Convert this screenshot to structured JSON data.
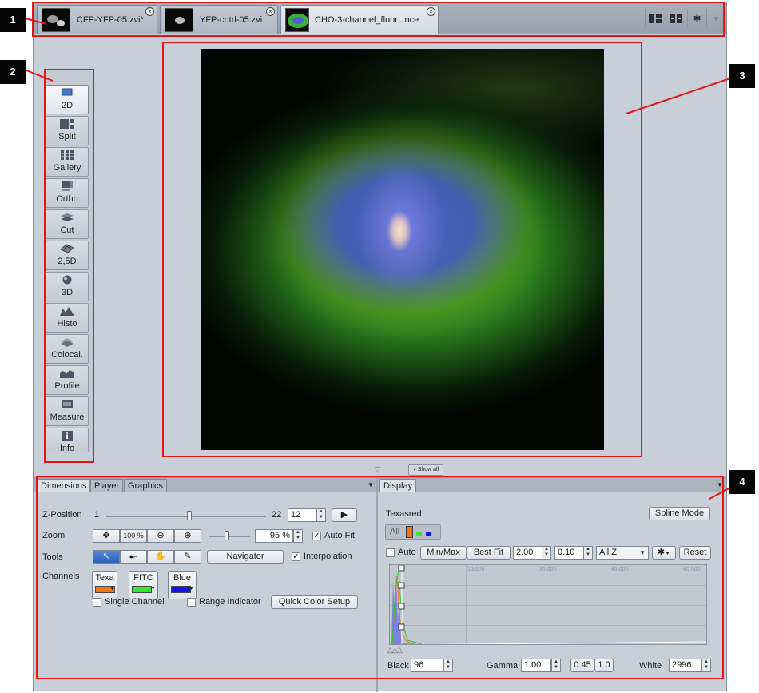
{
  "tabs": [
    {
      "label": "CFP-YFP-05.zvi*",
      "close": "×"
    },
    {
      "label": "YFP-cntrl-05.zvi",
      "close": "×"
    },
    {
      "label": "CHO-3-channel_fluor...nce",
      "close": "×"
    }
  ],
  "toolbar": {
    "icons": [
      "layout-icon",
      "split-view-icon",
      "gear-icon",
      "dropdown-icon"
    ],
    "gear": "✱",
    "dropdown": "▾"
  },
  "view_modes": [
    {
      "label": "2D",
      "icon": "monitor-icon"
    },
    {
      "label": "Split",
      "icon": "split-icon"
    },
    {
      "label": "Gallery",
      "icon": "gallery-icon"
    },
    {
      "label": "Ortho",
      "icon": "ortho-icon"
    },
    {
      "label": "Cut",
      "icon": "cut-icon"
    },
    {
      "label": "2,5D",
      "icon": "surface-icon"
    },
    {
      "label": "3D",
      "icon": "cube-icon"
    },
    {
      "label": "Histo",
      "icon": "histogram-icon"
    },
    {
      "label": "Colocal.",
      "icon": "colocalization-icon"
    },
    {
      "label": "Profile",
      "icon": "profile-icon"
    },
    {
      "label": "Measure",
      "icon": "measure-icon"
    },
    {
      "label": "Info",
      "icon": "info-icon",
      "glyph": "i"
    }
  ],
  "viewer": {
    "show_all": "✓Show all",
    "collapse": "▽"
  },
  "left_panel": {
    "tabs": [
      "Dimensions",
      "Player",
      "Graphics"
    ],
    "zposition": {
      "label": "Z-Position",
      "min": "1",
      "max": "22",
      "value": "12",
      "play": "▶",
      "fraction": 0.52
    },
    "zoom": {
      "label": "Zoom",
      "fit_glyph": "✥",
      "hundred": "100 %",
      "zoom_out": "⊖",
      "zoom_in": "⊕",
      "value": "95 %",
      "auto_fit": "Auto Fit",
      "auto_fit_checked": "✓"
    },
    "tools": {
      "label": "Tools",
      "glyphs": [
        "↖",
        "●⌐",
        "✋",
        "✎"
      ],
      "navigator": "Navigator",
      "interpolation": "Interpolation",
      "interpolation_checked": "✓"
    },
    "channels": {
      "label": "Channels",
      "items": [
        {
          "name": "Texa",
          "color": "#f07814"
        },
        {
          "name": "FITC",
          "color": "#32e632"
        },
        {
          "name": "Blue",
          "color": "#1414e6"
        }
      ],
      "single_channel": "Single Channel",
      "range_indicator": "Range Indicator",
      "quick_color_setup": "Quick Color Setup"
    }
  },
  "display_panel": {
    "tab": "Display",
    "channel_name": "Texasred",
    "spline_mode": "Spline Mode",
    "all": "All",
    "auto": "Auto",
    "min_max": "Min/Max",
    "best_fit": "Best Fit",
    "v1": "2.00",
    "v2": "0.10",
    "all_z": "All Z",
    "reset": "Reset",
    "axis_labels": [
      "15.000",
      "30.000",
      "45.000",
      "60.000"
    ],
    "black_label": "Black",
    "black_value": "96",
    "gamma_label": "Gamma",
    "gamma_value": "1.00",
    "gamma_preset_a": "0.45",
    "gamma_preset_b": "1.0",
    "white_label": "White",
    "white_value": "2996"
  },
  "annotations": [
    "1",
    "2",
    "3",
    "4"
  ],
  "colors": {
    "highlight": "#e31515",
    "accent": "#3a6fc4"
  }
}
